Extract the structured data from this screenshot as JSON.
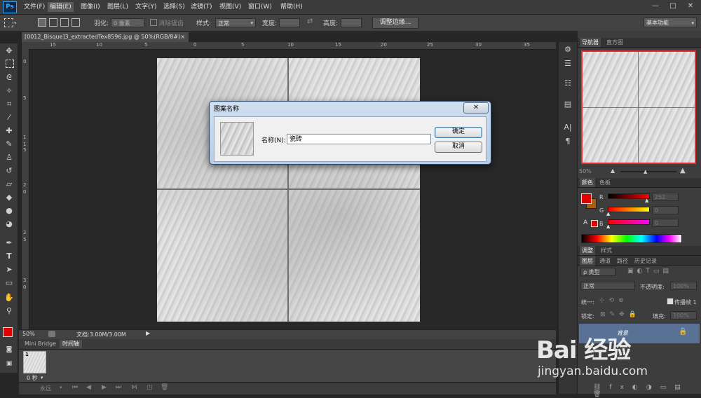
{
  "app": {
    "logo": "Ps"
  },
  "menubar": {
    "items": [
      {
        "label": "文件(F)"
      },
      {
        "label": "编辑(E)"
      },
      {
        "label": "图像(I)"
      },
      {
        "label": "图层(L)"
      },
      {
        "label": "文字(Y)"
      },
      {
        "label": "选择(S)"
      },
      {
        "label": "滤镜(T)"
      },
      {
        "label": "视图(V)"
      },
      {
        "label": "窗口(W)"
      },
      {
        "label": "帮助(H)"
      }
    ],
    "active": "编辑(E)",
    "window_buttons": [
      "—",
      "□",
      "✕"
    ]
  },
  "optionsbar": {
    "feather_label": "羽化:",
    "feather_value": "0 像素",
    "antialias_label": "消除锯齿",
    "style_label": "样式:",
    "style_value": "正常",
    "width_label": "宽度:",
    "height_label": "高度:",
    "refine_edge_button": "调整边缘...",
    "workspace_value": "基本功能"
  },
  "document": {
    "tab_title": "[0012_Bisque]3_extractedTex8596.jpg @ 50%(RGB/8#)",
    "close_glyph": "×",
    "ruler_h_ticks": [
      "15",
      "10",
      "5",
      "0",
      "5",
      "10",
      "15",
      "20",
      "25",
      "30",
      "35",
      "40"
    ],
    "ruler_v_ticks": [
      "0",
      "5",
      "1",
      "1",
      "5",
      "2",
      "0",
      "2",
      "5",
      "3",
      "0",
      "3",
      "5",
      "4",
      "0"
    ],
    "zoom": "50%",
    "doc_size": "文档:3.00M/3.00M"
  },
  "timeline": {
    "tabs": [
      {
        "label": "Mini Bridge"
      },
      {
        "label": "时间轴"
      }
    ],
    "frame_number": "1",
    "frame_delay": "0 秒",
    "loop_value": "永远"
  },
  "navigator": {
    "tabs": [
      {
        "label": "导航器"
      },
      {
        "label": "直方图"
      }
    ],
    "zoom": "50%"
  },
  "color_panel": {
    "tabs": [
      {
        "label": "颜色"
      },
      {
        "label": "色板"
      }
    ],
    "r_label": "R",
    "g_label": "G",
    "b_label": "B",
    "r_value": "252",
    "g_value": "0",
    "b_value": "0",
    "fg_color": "#e10000",
    "bg_color": "#b05a10"
  },
  "adjust_panel": {
    "tabs": [
      {
        "label": "调整"
      },
      {
        "label": "样式"
      }
    ]
  },
  "layers_panel": {
    "tabs": [
      {
        "label": "图层"
      },
      {
        "label": "通道"
      },
      {
        "label": "路径"
      },
      {
        "label": "历史记录"
      }
    ],
    "kind_label": "ρ 类型",
    "blend_mode": "正常",
    "opacity_label": "不透明度:",
    "opacity_value": "100%",
    "unify_label": "统一:",
    "propagate_label": "传播帧 1",
    "lock_label": "锁定:",
    "fill_label": "填充:",
    "fill_value": "100%",
    "layers": [
      {
        "name": "背景"
      }
    ]
  },
  "dialog": {
    "title": "图案名称",
    "close_glyph": "✕",
    "name_label": "名称(N):",
    "name_value": "瓷砖",
    "ok_label": "确定",
    "cancel_label": "取消"
  },
  "watermark": {
    "text": "Bai 经验",
    "url": "jingyan.baidu.com"
  }
}
